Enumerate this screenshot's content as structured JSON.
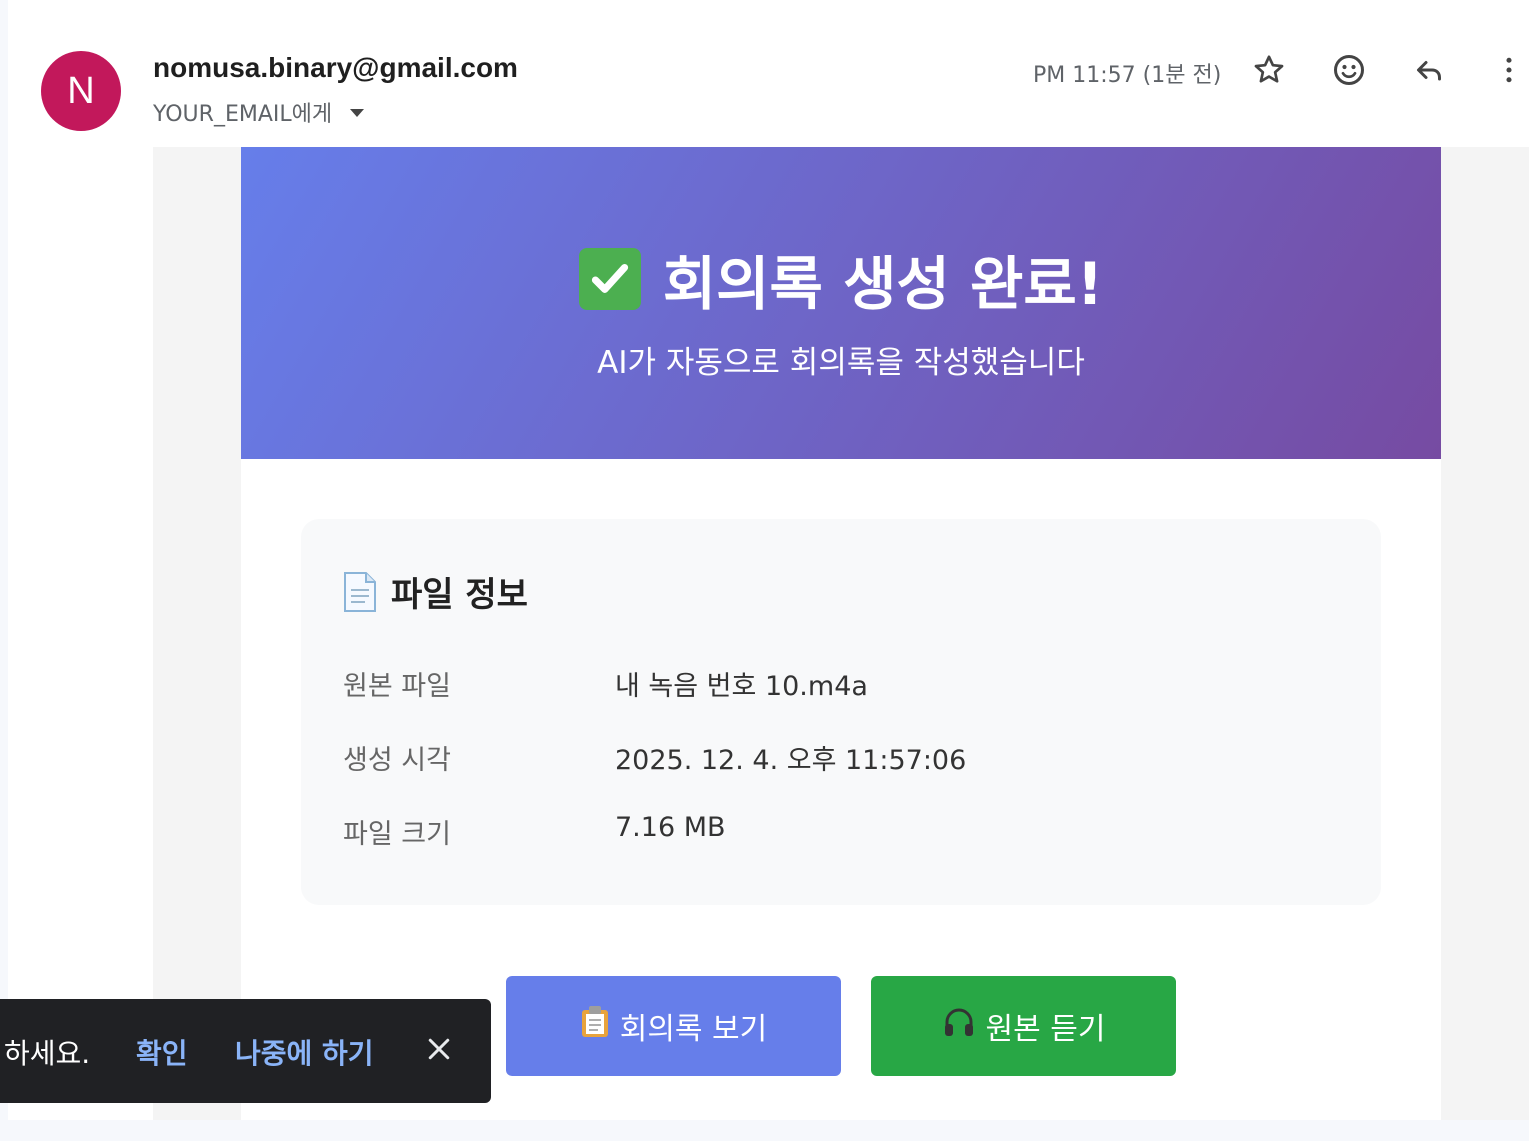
{
  "header": {
    "avatar_letter": "N",
    "sender": "nomusa.binary@gmail.com",
    "recipient": "YOUR_EMAIL에게",
    "time": "PM 11:57 (1분 전)"
  },
  "hero": {
    "title": "회의록 생성 완료!",
    "subtitle": "AI가 자동으로 회의록을 작성했습니다"
  },
  "file_info": {
    "title": "파일 정보",
    "rows": [
      {
        "label": "원본 파일",
        "value": "내 녹음 번호 10.m4a"
      },
      {
        "label": "생성 시각",
        "value": "2025. 12. 4. 오후 11:57:06"
      },
      {
        "label": "파일 크기",
        "value": "7.16 MB"
      }
    ]
  },
  "buttons": {
    "view_minutes": "회의록 보기",
    "listen_original": "원본 듣기"
  },
  "toast": {
    "message": "하세요.",
    "confirm": "확인",
    "later": "나중에 하기"
  },
  "colors": {
    "avatar": "#c2185b",
    "hero_start": "#667eea",
    "hero_end": "#764ba2",
    "view_button": "#667eea",
    "listen_button": "#28a745",
    "toast_link": "#8ab4f8"
  },
  "icons": [
    "star-icon",
    "emoji-icon",
    "reply-icon",
    "more-vert-icon",
    "check-icon",
    "document-icon",
    "clipboard-icon",
    "headphones-icon",
    "close-icon"
  ]
}
